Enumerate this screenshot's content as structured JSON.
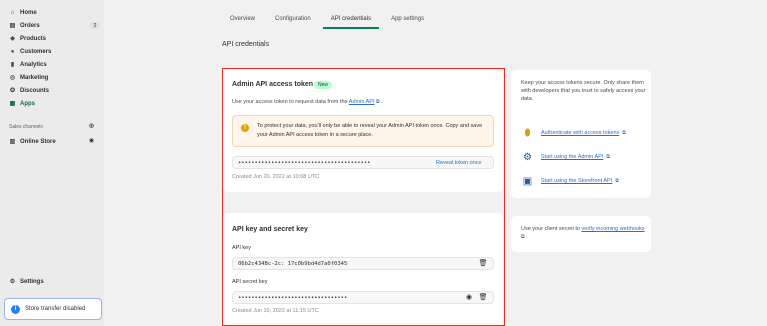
{
  "sidebar": {
    "items": [
      {
        "label": "Home",
        "icon": "home-icon",
        "glyph": "⌂"
      },
      {
        "label": "Orders",
        "icon": "orders-icon",
        "glyph": "▤",
        "badge": "2"
      },
      {
        "label": "Products",
        "icon": "products-icon",
        "glyph": "◆"
      },
      {
        "label": "Customers",
        "icon": "customers-icon",
        "glyph": "●"
      },
      {
        "label": "Analytics",
        "icon": "analytics-icon",
        "glyph": "▮"
      },
      {
        "label": "Marketing",
        "icon": "marketing-icon",
        "glyph": "◎"
      },
      {
        "label": "Discounts",
        "icon": "discounts-icon",
        "glyph": "✪"
      },
      {
        "label": "Apps",
        "icon": "apps-icon",
        "glyph": "▦",
        "active": true
      }
    ],
    "sales_channels_header": "Sales channels",
    "online_store": {
      "label": "Online Store",
      "icon": "store-icon",
      "glyph": "▥"
    },
    "settings": {
      "label": "Settings",
      "icon": "gear-icon",
      "glyph": "⚙"
    },
    "store_transfer": "Store transfer disabled"
  },
  "tabs": [
    {
      "label": "Overview"
    },
    {
      "label": "Configuration"
    },
    {
      "label": "API credentials",
      "active": true
    },
    {
      "label": "App settings"
    }
  ],
  "page_title": "API credentials",
  "admin_token": {
    "title": "Admin API access token",
    "badge": "New",
    "description_prefix": "Use your access token to request data from the ",
    "description_link": "Admin API",
    "description_suffix": " .",
    "banner_text": "To protect your data, you'll only be able to reveal your Admin API token once. Copy and save your Admin API access token in a secure place.",
    "token_masked": "••••••••••••••••••••••••••••••••••••••••",
    "reveal_label": "Reveal token once",
    "created": "Created Jun 20, 2022 at 10:08 UTC"
  },
  "api_keys": {
    "title": "API key and secret key",
    "api_key_label": "API key",
    "api_key_value": "06b2c434Bc-2c: 17c0b9bd4d7a0f0345",
    "secret_label": "API secret key",
    "secret_masked": "•••••••••••••••••••••••••••••••••",
    "created": "Created Jun 10, 2022 at 11:15 UTC"
  },
  "side_info": {
    "text": "Keep your access tokens secure. Only share them with developers that you trust to safely access your data.",
    "links": [
      {
        "label": "Authenticate with access tokens",
        "icon": "token-icon",
        "glyph": "⬮"
      },
      {
        "label": "Start using the Admin API",
        "icon": "gear-icon",
        "glyph": "⚙"
      },
      {
        "label": "Start using the Storefront API",
        "icon": "storefront-icon",
        "glyph": "▣"
      }
    ]
  },
  "side_secret": {
    "text_prefix": "Use your client secret to ",
    "link": "verify incoming webhooks",
    "text_suffix": " ."
  },
  "colors": {
    "accent": "#008060",
    "highlight": "#e32c2c",
    "link": "#2c6ecb"
  }
}
